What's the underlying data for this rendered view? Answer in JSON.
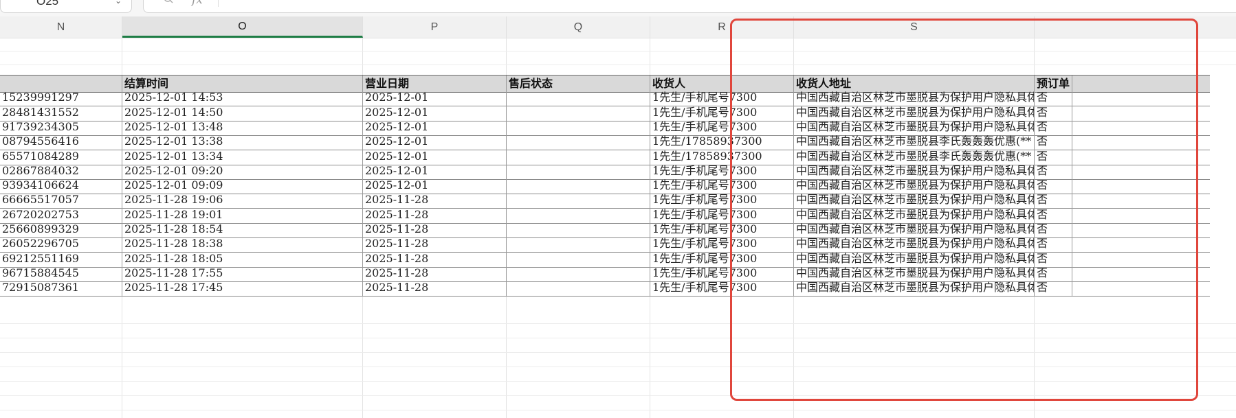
{
  "formula_bar": {
    "cell_ref": "O25",
    "fx_label": "fx",
    "formula_value": ""
  },
  "columns": [
    "N",
    "O",
    "P",
    "Q",
    "R",
    "S"
  ],
  "active_column": "O",
  "table": {
    "headers": [
      "",
      "结算时间",
      "营业日期",
      "售后状态",
      "收货人",
      "收货人地址",
      "预订单"
    ],
    "rows": [
      [
        "15239991297",
        "2025-12-01 14:53",
        "2025-12-01",
        "",
        "1先生/手机尾号7300",
        "中国西藏自治区林芝市墨脱县为保护用户隐私具体",
        "否"
      ],
      [
        "28481431552",
        "2025-12-01 14:50",
        "2025-12-01",
        "",
        "1先生/手机尾号7300",
        "中国西藏自治区林芝市墨脱县为保护用户隐私具体",
        "否"
      ],
      [
        "91739234305",
        "2025-12-01 13:48",
        "2025-12-01",
        "",
        "1先生/手机尾号7300",
        "中国西藏自治区林芝市墨脱县为保护用户隐私具体",
        "否"
      ],
      [
        "08794556416",
        "2025-12-01 13:38",
        "2025-12-01",
        "",
        "1先生/17858937300",
        "中国西藏自治区林芝市墨脱县李氏轰轰轰优惠(**",
        "否"
      ],
      [
        "65571084289",
        "2025-12-01 13:34",
        "2025-12-01",
        "",
        "1先生/17858937300",
        "中国西藏自治区林芝市墨脱县李氏轰轰轰优惠(**",
        "否"
      ],
      [
        "02867884032",
        "2025-12-01 09:20",
        "2025-12-01",
        "",
        "1先生/手机尾号7300",
        "中国西藏自治区林芝市墨脱县为保护用户隐私具体",
        "否"
      ],
      [
        "93934106624",
        "2025-12-01 09:09",
        "2025-12-01",
        "",
        "1先生/手机尾号7300",
        "中国西藏自治区林芝市墨脱县为保护用户隐私具体",
        "否"
      ],
      [
        "66665517057",
        "2025-11-28 19:06",
        "2025-11-28",
        "",
        "1先生/手机尾号7300",
        "中国西藏自治区林芝市墨脱县为保护用户隐私具体",
        "否"
      ],
      [
        "26720202753",
        "2025-11-28 19:01",
        "2025-11-28",
        "",
        "1先生/手机尾号7300",
        "中国西藏自治区林芝市墨脱县为保护用户隐私具体",
        "否"
      ],
      [
        "25660899329",
        "2025-11-28 18:54",
        "2025-11-28",
        "",
        "1先生/手机尾号7300",
        "中国西藏自治区林芝市墨脱县为保护用户隐私具体",
        "否"
      ],
      [
        "26052296705",
        "2025-11-28 18:38",
        "2025-11-28",
        "",
        "1先生/手机尾号7300",
        "中国西藏自治区林芝市墨脱县为保护用户隐私具体",
        "否"
      ],
      [
        "69212551169",
        "2025-11-28 18:05",
        "2025-11-28",
        "",
        "1先生/手机尾号7300",
        "中国西藏自治区林芝市墨脱县为保护用户隐私具体",
        "否"
      ],
      [
        "96715884545",
        "2025-11-28 17:55",
        "2025-11-28",
        "",
        "1先生/手机尾号7300",
        "中国西藏自治区林芝市墨脱县为保护用户隐私具体",
        "否"
      ],
      [
        "72915087361",
        "2025-11-28 17:45",
        "2025-11-28",
        "",
        "1先生/手机尾号7300",
        "中国西藏自治区林芝市墨脱县为保护用户隐私具体",
        "否"
      ]
    ]
  },
  "colors": {
    "active_column_underline": "#1e7d45",
    "highlight_box": "#e0463c",
    "header_fill": "#d9d9d9"
  }
}
